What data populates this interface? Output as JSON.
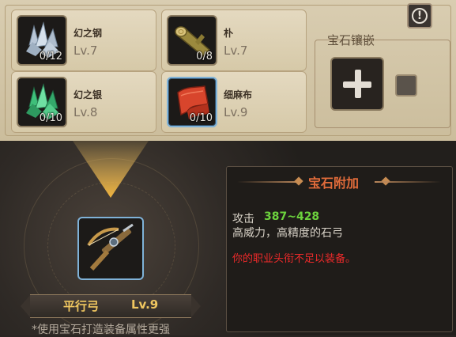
{
  "materials": [
    {
      "name": "幻之钢",
      "level": "Lv.7",
      "count": "0/12",
      "icon": "crystal-steel-icon"
    },
    {
      "name": "朴",
      "level": "Lv.7",
      "count": "0/8",
      "icon": "wood-log-icon"
    },
    {
      "name": "幻之银",
      "level": "Lv.8",
      "count": "0/10",
      "icon": "crystal-silver-icon"
    },
    {
      "name": "细麻布",
      "level": "Lv.9",
      "count": "0/10",
      "icon": "red-cloth-icon"
    }
  ],
  "inlay": {
    "title": "宝石镶嵌"
  },
  "info_icon": "!",
  "weapon": {
    "name": "平行弓",
    "level": "Lv.9",
    "icon": "crossbow-icon"
  },
  "hint": "*使用宝石打造装备属性更强",
  "gem_bonus": {
    "title": "宝石附加",
    "attack_label": "攻击",
    "attack_value": "387~428",
    "description": "高威力，高精度的石弓",
    "warning": "你的职业头衔不足以装备。"
  },
  "colors": {
    "accent_gold": "#f0c760",
    "bonus_title": "#e06b3a",
    "attack_green": "#6cd23d",
    "warning_red": "#ee2a2a"
  }
}
